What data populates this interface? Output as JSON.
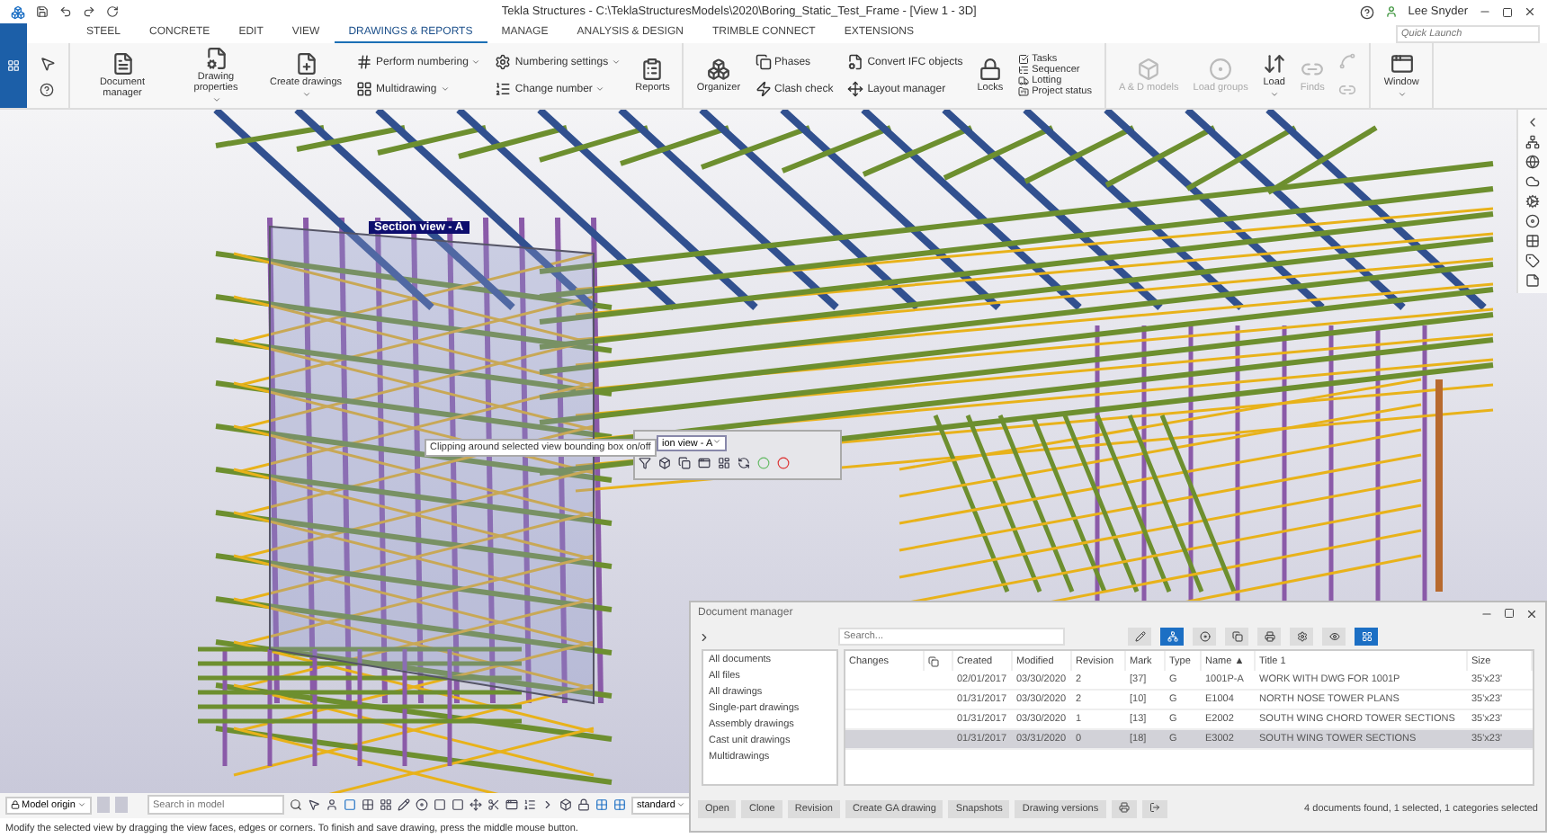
{
  "title_bar": {
    "title": "Tekla Structures - C:\\TeklaStructuresModels\\2020\\Boring_Static_Test_Frame - [View 1 - 3D]",
    "user": "Lee Snyder"
  },
  "tabs": [
    {
      "label": "STEEL",
      "selected": false
    },
    {
      "label": "CONCRETE",
      "selected": false
    },
    {
      "label": "EDIT",
      "selected": false
    },
    {
      "label": "VIEW",
      "selected": false
    },
    {
      "label": "DRAWINGS & REPORTS",
      "selected": true
    },
    {
      "label": "MANAGE",
      "selected": false
    },
    {
      "label": "ANALYSIS & DESIGN",
      "selected": false
    },
    {
      "label": "TRIMBLE CONNECT",
      "selected": false
    },
    {
      "label": "EXTENSIONS",
      "selected": false
    }
  ],
  "quick_launch": {
    "placeholder": "Quick Launch"
  },
  "ribbon": [
    {
      "columns": [
        {
          "kind": "large",
          "items": [
            {
              "label": "Document manager",
              "caret": false,
              "disabled": false
            }
          ]
        },
        {
          "kind": "large",
          "items": [
            {
              "label": "Drawing properties",
              "caret": true,
              "disabled": false
            }
          ]
        },
        {
          "kind": "large",
          "items": [
            {
              "label": "Create drawings",
              "caret": true,
              "disabled": false
            }
          ]
        },
        {
          "kind": "small",
          "items": [
            {
              "label": "Perform numbering",
              "caret": true,
              "disabled": false
            },
            {
              "label": "Multidrawing",
              "caret": true,
              "disabled": false
            }
          ]
        },
        {
          "kind": "small",
          "items": [
            {
              "label": "Numbering settings",
              "caret": true,
              "disabled": false
            },
            {
              "label": "Change number",
              "caret": true,
              "disabled": false
            }
          ]
        },
        {
          "kind": "large",
          "items": [
            {
              "label": "Reports",
              "caret": false,
              "disabled": false
            }
          ]
        }
      ]
    },
    {
      "columns": [
        {
          "kind": "large",
          "items": [
            {
              "label": "Organizer",
              "caret": false,
              "disabled": false
            }
          ]
        },
        {
          "kind": "small",
          "items": [
            {
              "label": "Phases",
              "caret": false,
              "disabled": false
            },
            {
              "label": "Clash check",
              "caret": false,
              "disabled": false
            }
          ]
        },
        {
          "kind": "small",
          "items": [
            {
              "label": "Convert IFC objects",
              "caret": false,
              "disabled": false
            },
            {
              "label": "Layout manager",
              "caret": false,
              "disabled": false
            }
          ]
        },
        {
          "kind": "large",
          "items": [
            {
              "label": "Locks",
              "caret": false,
              "disabled": false
            }
          ]
        },
        {
          "kind": "tiny",
          "items": [
            {
              "label": "Tasks",
              "caret": false,
              "disabled": false
            },
            {
              "label": "Sequencer",
              "caret": false,
              "disabled": false
            },
            {
              "label": "Lotting",
              "caret": false,
              "disabled": false
            },
            {
              "label": "Project status",
              "caret": false,
              "disabled": false
            }
          ]
        }
      ]
    },
    {
      "columns": [
        {
          "kind": "large",
          "items": [
            {
              "label": "A & D models",
              "caret": false,
              "disabled": true
            }
          ]
        },
        {
          "kind": "large",
          "items": [
            {
              "label": "Load groups",
              "caret": false,
              "disabled": true
            }
          ]
        },
        {
          "kind": "large",
          "items": [
            {
              "label": "Load",
              "caret": true,
              "disabled": false
            }
          ]
        },
        {
          "kind": "large",
          "items": [
            {
              "label": "Finds",
              "caret": false,
              "disabled": true
            }
          ]
        }
      ]
    },
    {
      "columns": [
        {
          "kind": "large",
          "items": [
            {
              "label": "Window",
              "caret": true,
              "disabled": false
            }
          ]
        }
      ]
    }
  ],
  "viewport": {
    "section_label": "Section view - A",
    "tooltip": "Clipping around selected view bounding box on/off",
    "view_dropdown": "ion view - A"
  },
  "document_manager": {
    "title": "Document manager",
    "search": {
      "placeholder": "Search..."
    },
    "tool_buttons": [
      {
        "selected": false
      },
      {
        "selected": true
      },
      {
        "selected": false
      },
      {
        "selected": false
      },
      {
        "selected": false
      },
      {
        "selected": false
      },
      {
        "selected": false
      },
      {
        "selected": true
      }
    ],
    "categories": [
      "All documents",
      "All files",
      "All drawings",
      "Single-part drawings",
      "Assembly drawings",
      "Cast unit drawings",
      "Multidrawings"
    ],
    "columns": [
      "Changes",
      "Created",
      "Modified",
      "Revision",
      "Mark",
      "Type",
      "Name ▲",
      "Title 1",
      "Size"
    ],
    "rows": [
      {
        "changes": "",
        "created": "02/01/2017",
        "modified": "03/30/2020",
        "revision": "2",
        "mark": "[37]",
        "type": "G",
        "name": "1001P-A",
        "title": "WORK WITH DWG FOR 1001P",
        "size": "35'x23'",
        "selected": false
      },
      {
        "changes": "",
        "created": "01/31/2017",
        "modified": "03/30/2020",
        "revision": "2",
        "mark": "[10]",
        "type": "G",
        "name": "E1004",
        "title": "NORTH NOSE TOWER PLANS",
        "size": "35'x23'",
        "selected": false
      },
      {
        "changes": "",
        "created": "01/31/2017",
        "modified": "03/30/2020",
        "revision": "1",
        "mark": "[13]",
        "type": "G",
        "name": "E2002",
        "title": "SOUTH WING CHORD TOWER SECTIONS",
        "size": "35'x23'",
        "selected": false
      },
      {
        "changes": "",
        "created": "01/31/2017",
        "modified": "03/31/2020",
        "revision": "0",
        "mark": "[18]",
        "type": "G",
        "name": "E3002",
        "title": "SOUTH WING TOWER SECTIONS",
        "size": "35'x23'",
        "selected": true
      }
    ],
    "buttons": [
      "Open",
      "Clone",
      "Revision",
      "Create GA drawing",
      "Snapshots",
      "Drawing versions"
    ],
    "status": "4 documents found, 1 selected, 1 categories selected"
  },
  "bottom_bar": {
    "origin": "Model origin",
    "search": {
      "placeholder": "Search in model"
    },
    "standard": "standard"
  },
  "status_bar": "Modify the selected view by dragging the view faces, edges or corners. To finish and save drawing, press the middle mouse button."
}
